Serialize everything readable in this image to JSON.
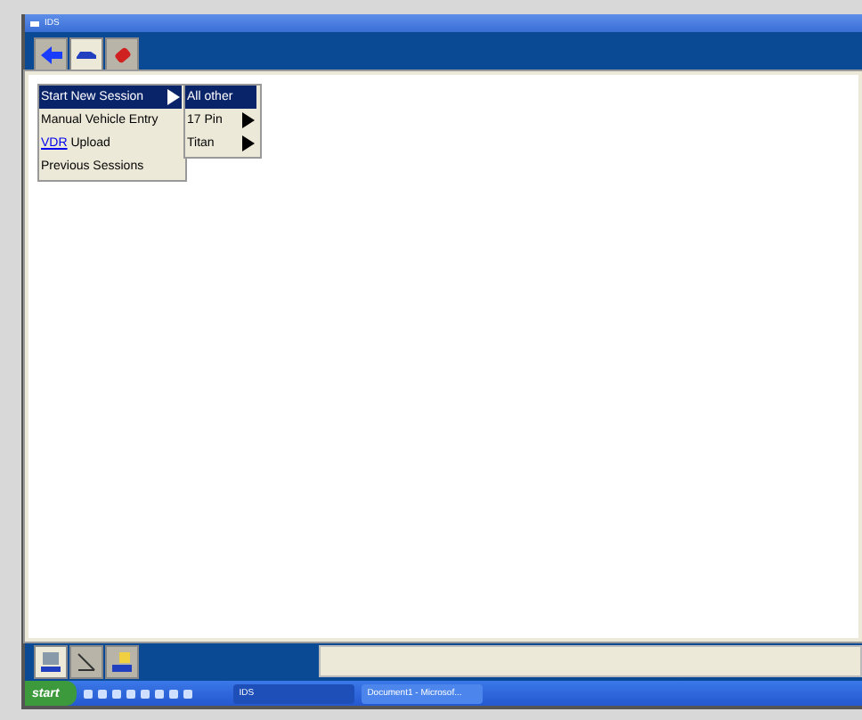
{
  "window": {
    "title": "IDS"
  },
  "top_tabs": [
    {
      "selected": false
    },
    {
      "selected": true
    },
    {
      "selected": false
    }
  ],
  "menu": [
    {
      "label": "Start New Session",
      "selected": true,
      "has_submenu": true
    },
    {
      "label": "Manual Vehicle Entry",
      "selected": false,
      "has_submenu": false
    },
    {
      "link": "VDR",
      "label": "Upload",
      "selected": false,
      "has_submenu": false
    },
    {
      "label": "Previous Sessions",
      "selected": false,
      "has_submenu": false
    }
  ],
  "submenu": [
    {
      "label": "All other",
      "selected": true,
      "has_submenu": false
    },
    {
      "label": "17 Pin",
      "selected": false,
      "has_submenu": true
    },
    {
      "label": "Titan",
      "selected": false,
      "has_submenu": true
    }
  ],
  "bottom_tabs": [
    {
      "selected": true
    },
    {
      "selected": false
    },
    {
      "selected": false
    }
  ],
  "taskbar": {
    "start": "start",
    "tasks": [
      {
        "label": "IDS",
        "selected": true
      },
      {
        "label": "Document1 - Microsof...",
        "selected": false
      }
    ]
  }
}
